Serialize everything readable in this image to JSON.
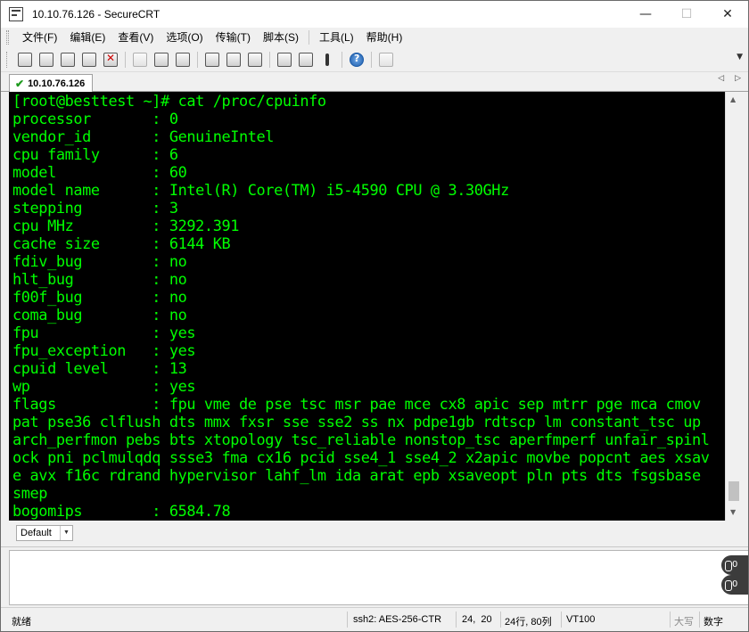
{
  "window": {
    "title": "10.10.76.126 - SecureCRT",
    "minimize": "—",
    "maximize": "☐",
    "close": "✕"
  },
  "menu": [
    {
      "label": "文件(F)"
    },
    {
      "label": "编辑(E)"
    },
    {
      "label": "查看(V)"
    },
    {
      "label": "选项(O)"
    },
    {
      "label": "传输(T)"
    },
    {
      "label": "脚本(S)"
    },
    {
      "label": "工具(L)"
    },
    {
      "label": "帮助(H)"
    }
  ],
  "tab": {
    "label": "10.10.76.126",
    "nav_prev": "◁",
    "nav_next": "▷"
  },
  "terminal": {
    "lines": [
      "[root@besttest ~]# cat /proc/cpuinfo",
      "processor       : 0",
      "vendor_id       : GenuineIntel",
      "cpu family      : 6",
      "model           : 60",
      "model name      : Intel(R) Core(TM) i5-4590 CPU @ 3.30GHz",
      "stepping        : 3",
      "cpu MHz         : 3292.391",
      "cache size      : 6144 KB",
      "fdiv_bug        : no",
      "hlt_bug         : no",
      "f00f_bug        : no",
      "coma_bug        : no",
      "fpu             : yes",
      "fpu_exception   : yes",
      "cpuid level     : 13",
      "wp              : yes",
      "flags           : fpu vme de pse tsc msr pae mce cx8 apic sep mtrr pge mca cmov",
      "pat pse36 clflush dts mmx fxsr sse sse2 ss nx pdpe1gb rdtscp lm constant_tsc up",
      "arch_perfmon pebs bts xtopology tsc_reliable nonstop_tsc aperfmperf unfair_spinl",
      "ock pni pclmulqdq ssse3 fma cx16 pcid sse4_1 sse4_2 x2apic movbe popcnt aes xsav",
      "e avx f16c rdrand hypervisor lahf_lm ida arat epb xsaveopt pln pts dts fsgsbase",
      "smep",
      "bogomips        : 6584.78"
    ]
  },
  "session": {
    "selected": "Default",
    "dropdown": "▼"
  },
  "badges": {
    "top": "0",
    "bottom": "0"
  },
  "status": {
    "ready": "就绪",
    "cipher": "ssh2: AES-256-CTR",
    "cursor_pos": "24,  20",
    "size": "24行, 80列",
    "emulation": "VT100",
    "caps": "大写",
    "num": "数字"
  }
}
